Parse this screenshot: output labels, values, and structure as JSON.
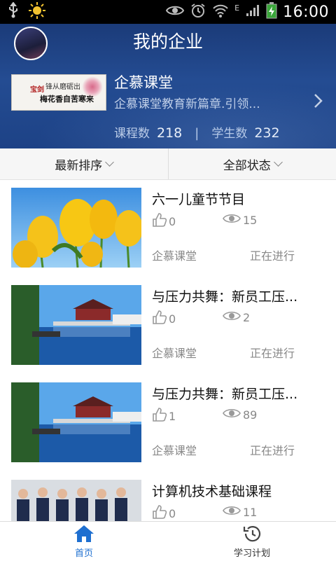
{
  "status_bar": {
    "time": "16:00",
    "network_label": "E"
  },
  "header": {
    "title": "我的企业",
    "org": {
      "name": "企慕课堂",
      "description": "企慕课堂教育新篇章.引领...",
      "thumb_seal": "宝剑",
      "thumb_line1": "锋从磨砺出",
      "thumb_line2": "梅花香自苦寒来",
      "stats": {
        "courses_label": "课程数",
        "courses_value": "218",
        "separator": "|",
        "students_label": "学生数",
        "students_value": "232"
      }
    }
  },
  "filters": {
    "sort_label": "最新排序",
    "status_label": "全部状态"
  },
  "courses": [
    {
      "title": "六一儿童节节目",
      "likes": "0",
      "views": "15",
      "owner": "企慕课堂",
      "status": "正在进行",
      "thumb": "tulips"
    },
    {
      "title": "与压力共舞：新员工压...",
      "likes": "0",
      "views": "2",
      "owner": "企慕课堂",
      "status": "正在进行",
      "thumb": "lake"
    },
    {
      "title": "与压力共舞：新员工压...",
      "likes": "1",
      "views": "89",
      "owner": "企慕课堂",
      "status": "正在进行",
      "thumb": "lake"
    },
    {
      "title": "计算机技术基础课程",
      "likes": "0",
      "views": "11",
      "owner": "",
      "status": "",
      "thumb": "group"
    }
  ],
  "bottom_nav": {
    "home_label": "首页",
    "plan_label": "学习计划"
  },
  "colors": {
    "accent": "#1e6fd0",
    "header_blue": "#244c92"
  }
}
